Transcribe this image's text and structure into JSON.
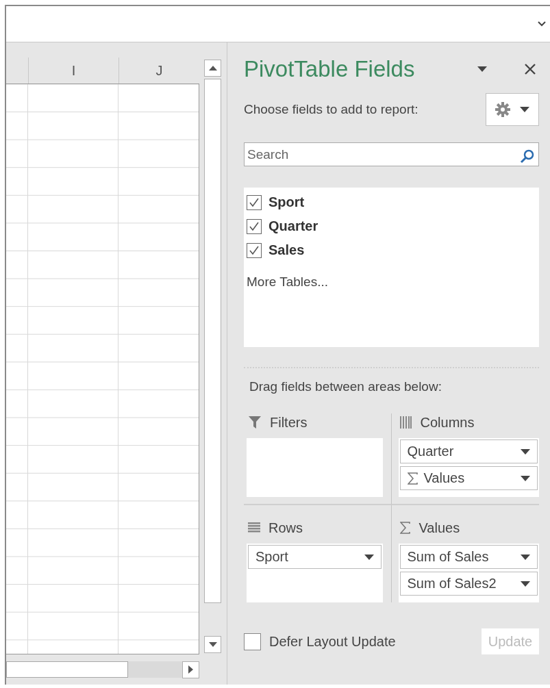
{
  "sheet": {
    "column_headers": [
      "I",
      "J"
    ]
  },
  "panel": {
    "title": "PivotTable Fields",
    "choose_label": "Choose fields to add to report:",
    "search": {
      "placeholder": "Search"
    },
    "fields": [
      {
        "label": "Sport",
        "checked": true
      },
      {
        "label": "Quarter",
        "checked": true
      },
      {
        "label": "Sales",
        "checked": true
      }
    ],
    "more_tables": "More Tables...",
    "drag_label": "Drag fields between areas below:",
    "areas": [
      {
        "kind": "filters",
        "label": "Filters"
      },
      {
        "kind": "columns",
        "label": "Columns",
        "items": [
          {
            "label": "Quarter",
            "kind": "field"
          },
          {
            "label": "Values",
            "kind": "values"
          }
        ]
      },
      {
        "kind": "rows",
        "label": "Rows",
        "items": [
          {
            "label": "Sport",
            "kind": "field"
          }
        ]
      },
      {
        "kind": "values",
        "label": "Values",
        "items": [
          {
            "label": "Sum of Sales",
            "kind": "field"
          },
          {
            "label": "Sum of Sales2",
            "kind": "field"
          }
        ]
      }
    ],
    "defer": {
      "label": "Defer Layout Update",
      "checked": false
    },
    "update": {
      "label": "Update",
      "disabled": true
    }
  }
}
